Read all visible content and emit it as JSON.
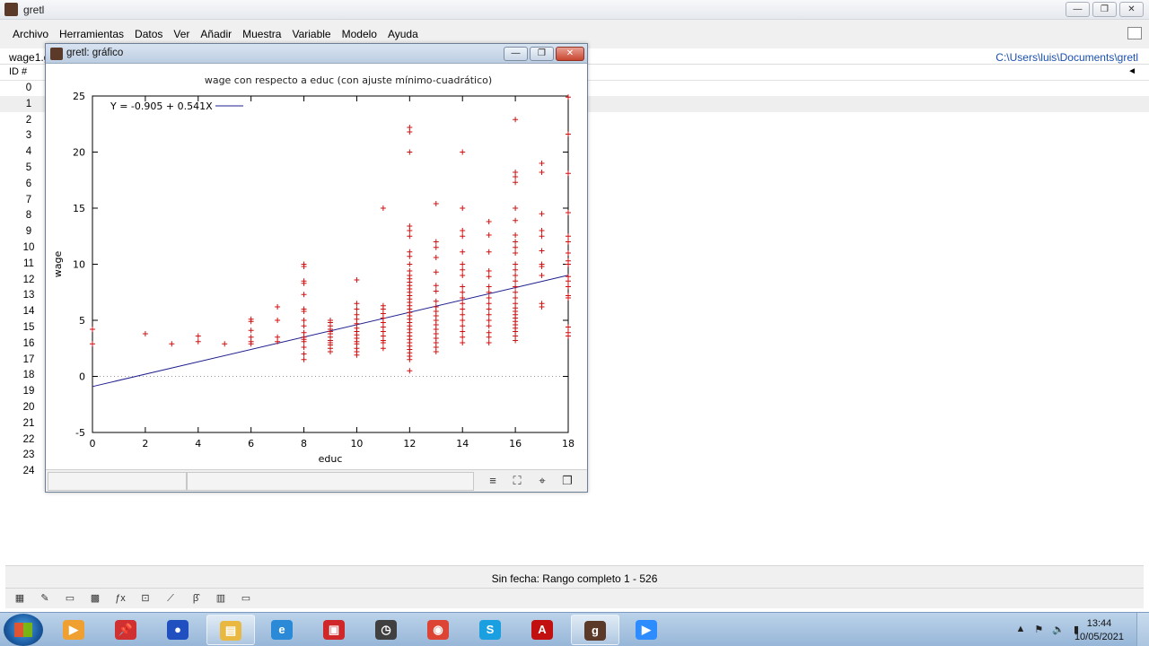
{
  "main_window": {
    "title": "gretl",
    "controls": [
      "—",
      "❐",
      "✕"
    ]
  },
  "menu": [
    "Archivo",
    "Herramientas",
    "Datos",
    "Ver",
    "Añadir",
    "Muestra",
    "Variable",
    "Modelo",
    "Ayuda"
  ],
  "info_bar": {
    "file": "wage1.g",
    "path": "C:\\Users\\luis\\Documents\\gretl"
  },
  "list_header": {
    "id_label": "ID #"
  },
  "row_ids": [
    "0",
    "1",
    "2",
    "3",
    "4",
    "5",
    "6",
    "7",
    "8",
    "9",
    "10",
    "11",
    "12",
    "13",
    "14",
    "15",
    "16",
    "17",
    "18",
    "19",
    "20",
    "21",
    "22",
    "23",
    "24"
  ],
  "status": {
    "text": "Sin fecha: Rango completo 1 - 526"
  },
  "bottom_toolbar": [
    "calculator-icon",
    "script-icon",
    "console-icon",
    "session-icon",
    "function-icon",
    "help-icon",
    "graph-icon",
    "beta-icon",
    "database-icon",
    "folder-icon"
  ],
  "graph_window": {
    "title": "gretl: gráfico",
    "controls": [
      "—",
      "❐",
      "✕"
    ],
    "status_icons": [
      "menu-icon",
      "zoom-icon",
      "crosshair-icon",
      "window-icon"
    ]
  },
  "chart_data": {
    "type": "scatter",
    "title": "wage con respecto a educ (con ajuste mínimo-cuadrático)",
    "xlabel": "educ",
    "ylabel": "wage",
    "xlim": [
      0,
      18
    ],
    "ylim": [
      -5,
      25
    ],
    "xticks": [
      "0",
      "2",
      "4",
      "6",
      "8",
      "10",
      "12",
      "14",
      "16",
      "18"
    ],
    "yticks": [
      "-5",
      "0",
      "5",
      "10",
      "15",
      "20",
      "25"
    ],
    "grid": false,
    "zero_line": true,
    "legend_position": "top-left",
    "fit": {
      "label": "Y = -0.905 + 0.541X",
      "intercept": -0.905,
      "slope": 0.541,
      "color": "#1f1f8f"
    },
    "point_color": "#d01010",
    "points": [
      [
        0,
        4.2
      ],
      [
        0,
        2.9
      ],
      [
        2,
        3.8
      ],
      [
        3,
        2.9
      ],
      [
        4,
        3.6
      ],
      [
        4,
        3.1
      ],
      [
        5,
        2.9
      ],
      [
        6,
        5.1
      ],
      [
        6,
        4.9
      ],
      [
        6,
        4.1
      ],
      [
        6,
        3.5
      ],
      [
        6,
        3.1
      ],
      [
        6,
        2.9
      ],
      [
        7,
        6.2
      ],
      [
        7,
        5.0
      ],
      [
        7,
        3.5
      ],
      [
        7,
        3.1
      ],
      [
        8,
        10.0
      ],
      [
        8,
        9.8
      ],
      [
        8,
        8.5
      ],
      [
        8,
        8.3
      ],
      [
        8,
        7.3
      ],
      [
        8,
        6.0
      ],
      [
        8,
        5.8
      ],
      [
        8,
        5.0
      ],
      [
        8,
        4.5
      ],
      [
        8,
        3.9
      ],
      [
        8,
        3.5
      ],
      [
        8,
        3.3
      ],
      [
        8,
        3.1
      ],
      [
        8,
        2.6
      ],
      [
        8,
        2.0
      ],
      [
        8,
        1.5
      ],
      [
        9,
        5.0
      ],
      [
        9,
        4.8
      ],
      [
        9,
        4.5
      ],
      [
        9,
        4.2
      ],
      [
        9,
        4.0
      ],
      [
        9,
        3.8
      ],
      [
        9,
        3.5
      ],
      [
        9,
        3.2
      ],
      [
        9,
        3.0
      ],
      [
        9,
        2.8
      ],
      [
        9,
        2.5
      ],
      [
        9,
        2.2
      ],
      [
        10,
        8.6
      ],
      [
        10,
        6.5
      ],
      [
        10,
        6.0
      ],
      [
        10,
        5.5
      ],
      [
        10,
        5.1
      ],
      [
        10,
        4.7
      ],
      [
        10,
        4.3
      ],
      [
        10,
        4.0
      ],
      [
        10,
        3.7
      ],
      [
        10,
        3.4
      ],
      [
        10,
        3.1
      ],
      [
        10,
        2.9
      ],
      [
        10,
        2.5
      ],
      [
        10,
        2.2
      ],
      [
        10,
        1.9
      ],
      [
        11,
        15.0
      ],
      [
        11,
        6.3
      ],
      [
        11,
        6.0
      ],
      [
        11,
        5.6
      ],
      [
        11,
        5.2
      ],
      [
        11,
        4.8
      ],
      [
        11,
        4.4
      ],
      [
        11,
        4.0
      ],
      [
        11,
        3.6
      ],
      [
        11,
        3.2
      ],
      [
        11,
        3.0
      ],
      [
        11,
        2.5
      ],
      [
        12,
        22.2
      ],
      [
        12,
        21.8
      ],
      [
        12,
        20.0
      ],
      [
        12,
        13.4
      ],
      [
        12,
        13.0
      ],
      [
        12,
        12.5
      ],
      [
        12,
        11.1
      ],
      [
        12,
        10.7
      ],
      [
        12,
        10.0
      ],
      [
        12,
        9.4
      ],
      [
        12,
        9.0
      ],
      [
        12,
        8.7
      ],
      [
        12,
        8.4
      ],
      [
        12,
        8.1
      ],
      [
        12,
        7.8
      ],
      [
        12,
        7.5
      ],
      [
        12,
        7.2
      ],
      [
        12,
        6.9
      ],
      [
        12,
        6.6
      ],
      [
        12,
        6.3
      ],
      [
        12,
        6.0
      ],
      [
        12,
        5.7
      ],
      [
        12,
        5.4
      ],
      [
        12,
        5.1
      ],
      [
        12,
        4.8
      ],
      [
        12,
        4.5
      ],
      [
        12,
        4.2
      ],
      [
        12,
        3.9
      ],
      [
        12,
        3.6
      ],
      [
        12,
        3.3
      ],
      [
        12,
        3.0
      ],
      [
        12,
        2.7
      ],
      [
        12,
        2.4
      ],
      [
        12,
        2.1
      ],
      [
        12,
        1.8
      ],
      [
        12,
        1.5
      ],
      [
        12,
        0.5
      ],
      [
        13,
        15.4
      ],
      [
        13,
        12.0
      ],
      [
        13,
        11.5
      ],
      [
        13,
        10.6
      ],
      [
        13,
        9.3
      ],
      [
        13,
        8.1
      ],
      [
        13,
        7.6
      ],
      [
        13,
        6.7
      ],
      [
        13,
        6.2
      ],
      [
        13,
        5.8
      ],
      [
        13,
        5.4
      ],
      [
        13,
        5.0
      ],
      [
        13,
        4.6
      ],
      [
        13,
        4.2
      ],
      [
        13,
        3.8
      ],
      [
        13,
        3.4
      ],
      [
        13,
        3.0
      ],
      [
        13,
        2.6
      ],
      [
        13,
        2.2
      ],
      [
        14,
        20.0
      ],
      [
        14,
        15.0
      ],
      [
        14,
        13.0
      ],
      [
        14,
        12.5
      ],
      [
        14,
        11.1
      ],
      [
        14,
        10.0
      ],
      [
        14,
        9.5
      ],
      [
        14,
        9.0
      ],
      [
        14,
        8.0
      ],
      [
        14,
        7.5
      ],
      [
        14,
        7.0
      ],
      [
        14,
        6.5
      ],
      [
        14,
        6.0
      ],
      [
        14,
        5.5
      ],
      [
        14,
        5.0
      ],
      [
        14,
        4.5
      ],
      [
        14,
        4.0
      ],
      [
        14,
        3.5
      ],
      [
        14,
        3.0
      ],
      [
        15,
        13.8
      ],
      [
        15,
        12.6
      ],
      [
        15,
        11.1
      ],
      [
        15,
        9.4
      ],
      [
        15,
        8.9
      ],
      [
        15,
        8.0
      ],
      [
        15,
        7.5
      ],
      [
        15,
        7.0
      ],
      [
        15,
        6.5
      ],
      [
        15,
        6.0
      ],
      [
        15,
        5.5
      ],
      [
        15,
        5.0
      ],
      [
        15,
        4.5
      ],
      [
        15,
        3.9
      ],
      [
        15,
        3.5
      ],
      [
        15,
        3.0
      ],
      [
        16,
        22.9
      ],
      [
        16,
        18.2
      ],
      [
        16,
        17.8
      ],
      [
        16,
        17.3
      ],
      [
        16,
        15.0
      ],
      [
        16,
        13.9
      ],
      [
        16,
        12.6
      ],
      [
        16,
        12.0
      ],
      [
        16,
        11.5
      ],
      [
        16,
        11.0
      ],
      [
        16,
        10.0
      ],
      [
        16,
        9.5
      ],
      [
        16,
        9.0
      ],
      [
        16,
        8.5
      ],
      [
        16,
        8.0
      ],
      [
        16,
        7.5
      ],
      [
        16,
        7.0
      ],
      [
        16,
        6.5
      ],
      [
        16,
        6.1
      ],
      [
        16,
        5.8
      ],
      [
        16,
        5.5
      ],
      [
        16,
        5.2
      ],
      [
        16,
        4.9
      ],
      [
        16,
        4.6
      ],
      [
        16,
        4.3
      ],
      [
        16,
        4.0
      ],
      [
        16,
        3.6
      ],
      [
        16,
        3.2
      ],
      [
        17,
        19.0
      ],
      [
        17,
        18.2
      ],
      [
        17,
        14.5
      ],
      [
        17,
        13.0
      ],
      [
        17,
        12.5
      ],
      [
        17,
        11.2
      ],
      [
        17,
        10.0
      ],
      [
        17,
        9.8
      ],
      [
        17,
        9.0
      ],
      [
        17,
        6.5
      ],
      [
        17,
        6.2
      ],
      [
        18,
        24.9
      ],
      [
        18,
        21.6
      ],
      [
        18,
        18.1
      ],
      [
        18,
        14.6
      ],
      [
        18,
        12.5
      ],
      [
        18,
        12.0
      ],
      [
        18,
        11.0
      ],
      [
        18,
        10.3
      ],
      [
        18,
        10.0
      ],
      [
        18,
        8.9
      ],
      [
        18,
        8.5
      ],
      [
        18,
        8.0
      ],
      [
        18,
        7.2
      ],
      [
        18,
        7.0
      ],
      [
        18,
        4.4
      ],
      [
        18,
        3.9
      ],
      [
        18,
        3.6
      ]
    ]
  },
  "taskbar": {
    "apps": [
      {
        "name": "media-player",
        "color": "#f0a030",
        "glyph": "▶"
      },
      {
        "name": "pin-app",
        "color": "#d03030",
        "glyph": "📌"
      },
      {
        "name": "user-app",
        "color": "#2050c0",
        "glyph": "●"
      },
      {
        "name": "explorer",
        "color": "#e8b840",
        "glyph": "▤",
        "active": true
      },
      {
        "name": "internet-explorer",
        "color": "#2a8ad8",
        "glyph": "e"
      },
      {
        "name": "video-app",
        "color": "#d02828",
        "glyph": "▣"
      },
      {
        "name": "clock-app",
        "color": "#404040",
        "glyph": "◷"
      },
      {
        "name": "chrome",
        "color": "#dd4433",
        "glyph": "◉"
      },
      {
        "name": "skype",
        "color": "#1aa0e0",
        "glyph": "S"
      },
      {
        "name": "acrobat",
        "color": "#c21010",
        "glyph": "A"
      },
      {
        "name": "gretl",
        "color": "#5b3a2a",
        "glyph": "g",
        "active": true
      },
      {
        "name": "zoom",
        "color": "#2d8cff",
        "glyph": "▶"
      }
    ],
    "time": "13:44",
    "date": "10/05/2021"
  }
}
